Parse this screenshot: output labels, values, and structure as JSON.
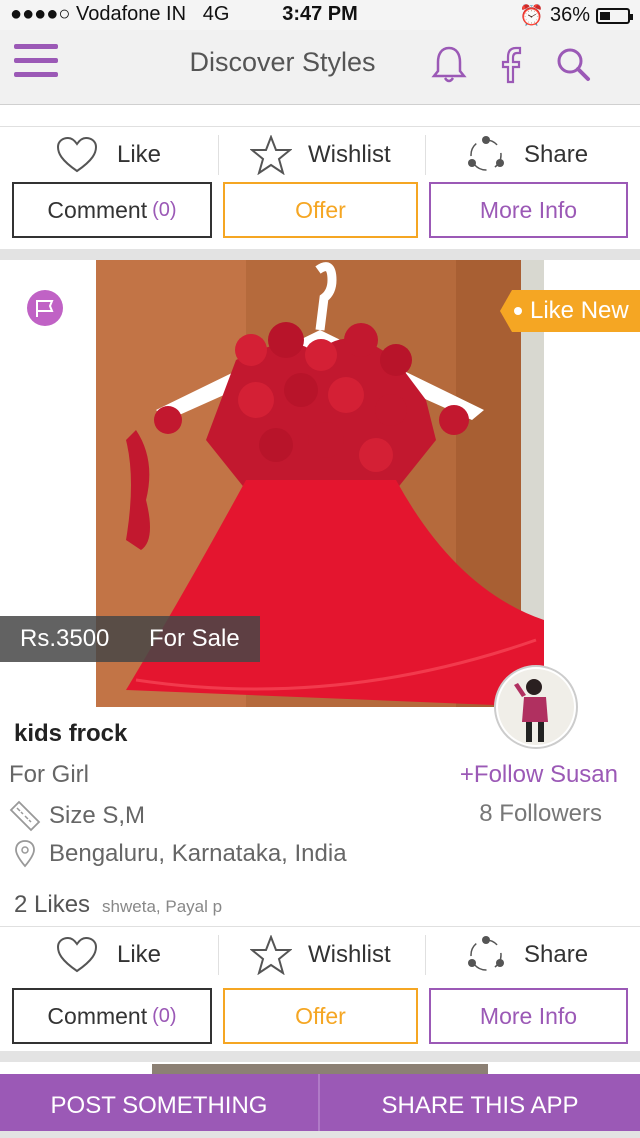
{
  "status": {
    "carrier": "●●●●○ Vodafone IN",
    "network": "4G",
    "time": "3:47 PM",
    "battery": "36%"
  },
  "header": {
    "title": "Discover Styles",
    "icons": [
      "menu-icon",
      "bell-icon",
      "facebook-icon",
      "search-icon"
    ]
  },
  "actions": {
    "like": "Like",
    "wishlist": "Wishlist",
    "share": "Share"
  },
  "buttons": {
    "comment": "Comment",
    "comment_count": "(0)",
    "offer": "Offer",
    "more_info": "More Info"
  },
  "post": {
    "condition": "Like New",
    "price": "Rs.3500",
    "sale_type": "For Sale",
    "title": "kids frock",
    "category": "For Girl",
    "size": "Size S,M",
    "location": "Bengaluru, Karnataka, India",
    "follow": "+Follow Susan",
    "followers": "8 Followers",
    "likes": "2 Likes",
    "liked_by": "shweta, Payal p"
  },
  "bottom": {
    "post": "POST SOMETHING",
    "share": "SHARE THIS APP"
  },
  "colors": {
    "accent": "#9b59b6",
    "offer": "#f5a623"
  }
}
